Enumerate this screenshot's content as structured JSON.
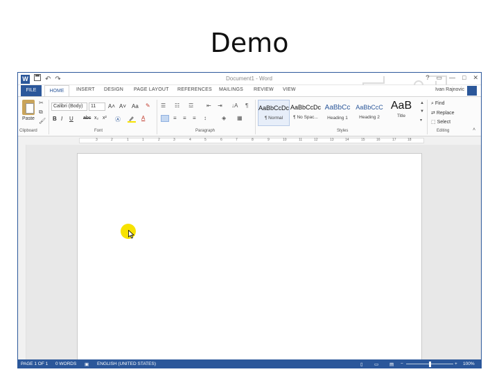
{
  "slide": {
    "title": "Demo"
  },
  "titlebar": {
    "app_badge": "W",
    "save_icon": "save-icon",
    "undo_glyph": "↶",
    "redo_glyph": "↷",
    "document_title": "Document1 - Word",
    "window_controls": [
      "?",
      "▭",
      "—",
      "□",
      "✕"
    ]
  },
  "tabs": {
    "file": "FILE",
    "home": "HOME",
    "items": [
      "INSERT",
      "DESIGN",
      "PAGE LAYOUT",
      "REFERENCES",
      "MAILINGS",
      "REVIEW",
      "VIEW"
    ],
    "user": "Ivan Rajnovic"
  },
  "ribbon": {
    "clipboard": {
      "paste": "Paste",
      "label": "Clipboard"
    },
    "font": {
      "name": "Calibri (Body)",
      "size": "11",
      "label": "Font",
      "bold": "B",
      "italic": "I",
      "underline": "U",
      "strike": "abc",
      "subscript": "x₂",
      "superscript": "x²",
      "grow": "A˄",
      "shrink": "A˅",
      "case": "Aa",
      "color": "A"
    },
    "paragraph": {
      "label": "Paragraph",
      "sort": "↓A",
      "pilcrow": "¶"
    },
    "styles": {
      "label": "Styles",
      "items": [
        {
          "sample": "AaBbCcDc",
          "name": "¶ Normal"
        },
        {
          "sample": "AaBbCcDc",
          "name": "¶ No Spac..."
        },
        {
          "sample": "AaBbCc",
          "name": "Heading 1"
        },
        {
          "sample": "AaBbCcC",
          "name": "Heading 2"
        },
        {
          "sample": "AaB",
          "name": "Title"
        }
      ]
    },
    "editing": {
      "label": "Editing",
      "find": "Find",
      "replace": "Replace",
      "select": "Select"
    }
  },
  "ruler": {
    "numbers": [
      "3",
      "2",
      "1",
      "1",
      "2",
      "3",
      "4",
      "5",
      "6",
      "7",
      "8",
      "9",
      "10",
      "11",
      "12",
      "13",
      "14",
      "15",
      "16",
      "17",
      "18"
    ]
  },
  "statusbar": {
    "page": "PAGE 1 OF 1",
    "words": "0 WORDS",
    "language": "ENGLISH (UNITED STATES)",
    "zoom": "100%",
    "zoom_level": 0.5
  },
  "colors": {
    "accent": "#2b579a",
    "highlight": "#f7e200"
  }
}
